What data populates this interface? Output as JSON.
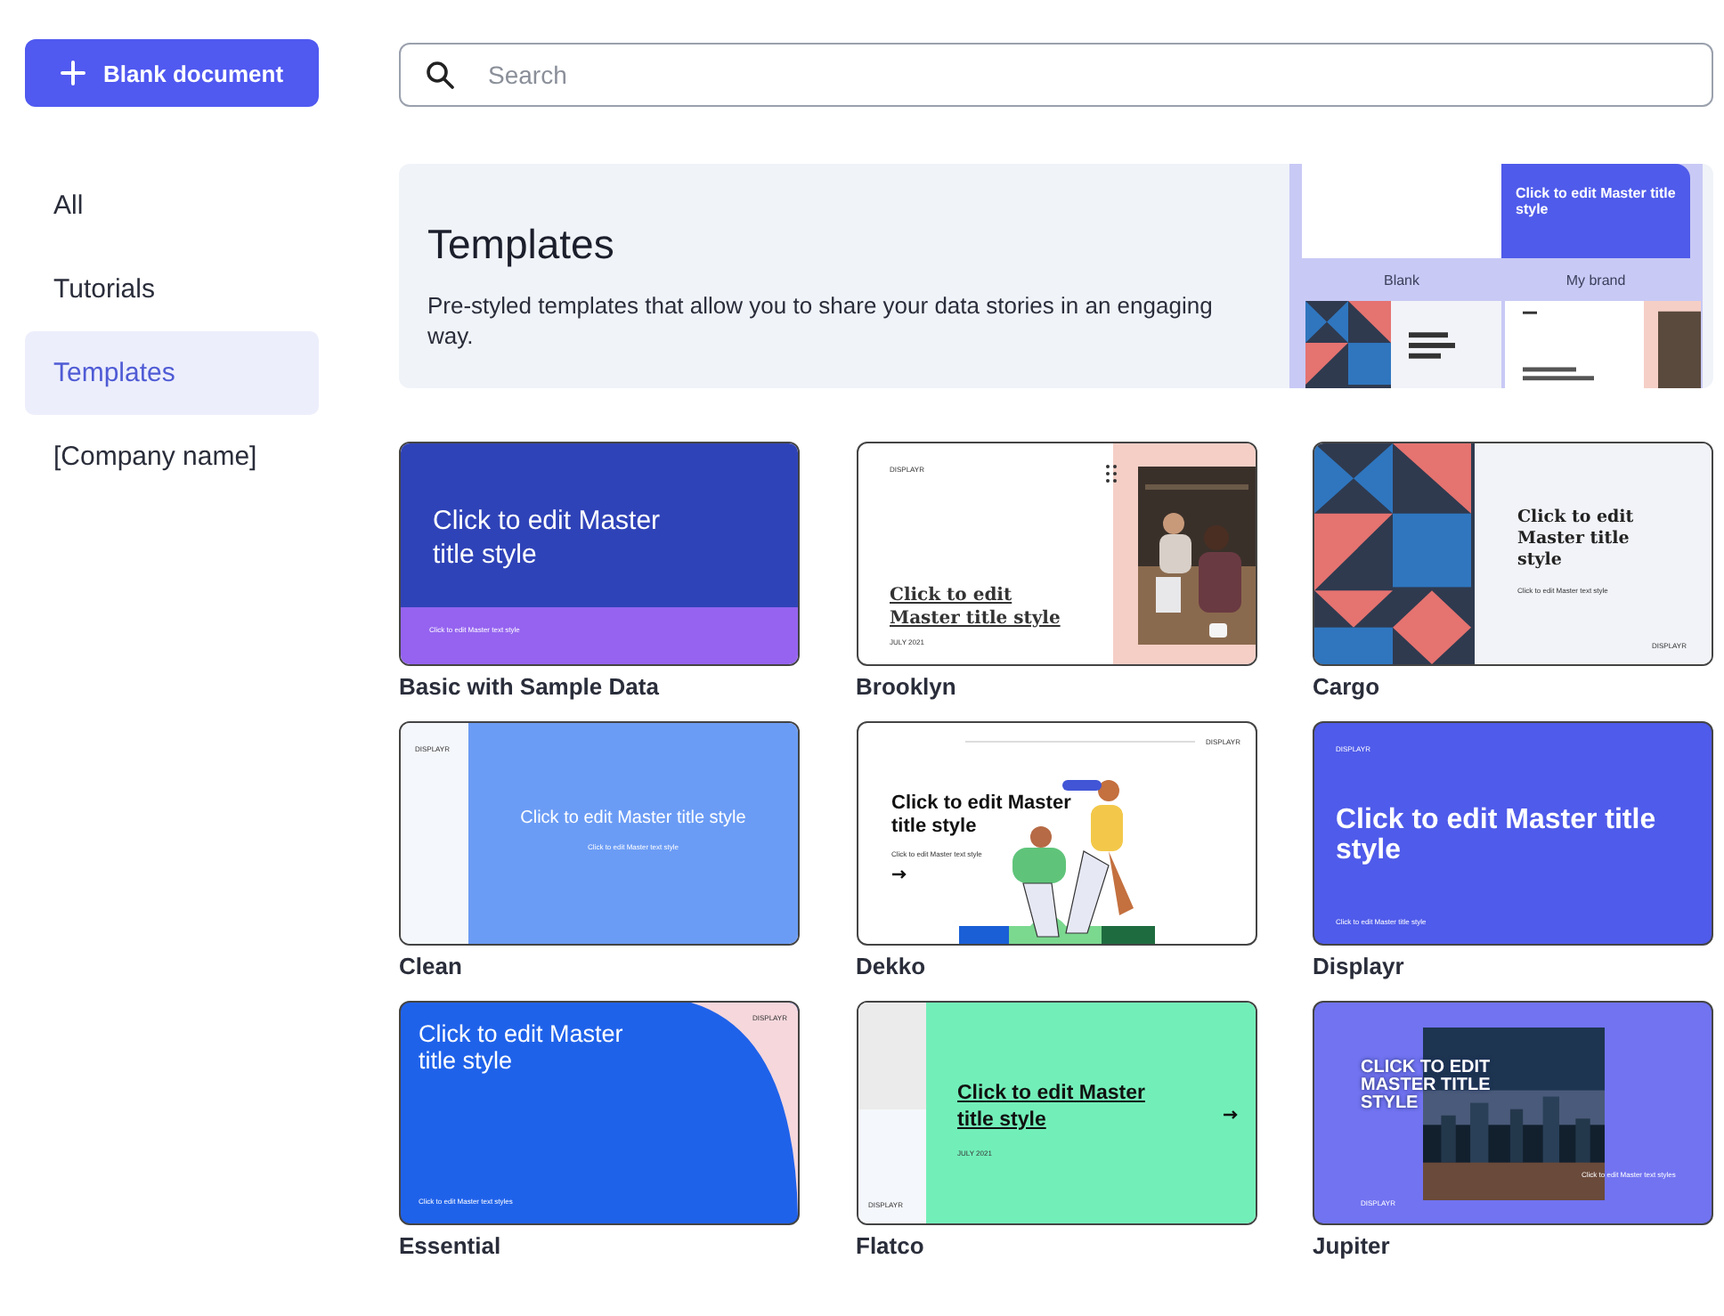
{
  "new_button": {
    "label": "Blank document"
  },
  "search": {
    "placeholder": "Search"
  },
  "sidebar": {
    "items": [
      {
        "label": "All",
        "selected": false
      },
      {
        "label": "Tutorials",
        "selected": false
      },
      {
        "label": "Templates",
        "selected": true
      },
      {
        "label": "[Company name]",
        "selected": false
      }
    ]
  },
  "banner": {
    "title": "Templates",
    "description": "Pre-styled templates that allow you to share your data stories in an engaging way.",
    "preview": {
      "brand_title": "Click to edit Master title style",
      "labels": [
        "Blank",
        "My brand"
      ]
    }
  },
  "templates": [
    {
      "name": "Basic with Sample Data",
      "kind": "basic",
      "title": "Click to edit Master title style",
      "subtitle": "Click to edit Master text style"
    },
    {
      "name": "Brooklyn",
      "kind": "brooklyn",
      "brand": "DISPLAYR",
      "title": "Click to edit Master title style",
      "date": "JULY 2021"
    },
    {
      "name": "Cargo",
      "kind": "cargo",
      "title": "Click to edit Master title style",
      "subtitle": "Click to edit Master text style",
      "brand": "DISPLAYR"
    },
    {
      "name": "Clean",
      "kind": "clean",
      "brand": "DISPLAYR",
      "title": "Click to edit Master title style",
      "subtitle": "Click to edit Master text style"
    },
    {
      "name": "Dekko",
      "kind": "dekko",
      "brand": "DISPLAYR",
      "title": "Click to edit Master title style",
      "subtitle": "Click to edit Master text style"
    },
    {
      "name": "Displayr",
      "kind": "displayr",
      "brand": "DISPLAYR",
      "title": "Click to edit Master title style",
      "subtitle": "Click to edit Master title style"
    },
    {
      "name": "Essential",
      "kind": "essential",
      "brand": "DISPLAYR",
      "title": "Click to edit Master title style",
      "subtitle": "Click to edit Master text styles"
    },
    {
      "name": "Flatco",
      "kind": "flatco",
      "title": "Click to edit Master title style",
      "date": "JULY 2021",
      "brand": "DISPLAYR"
    },
    {
      "name": "Jupiter",
      "kind": "jupiter",
      "title": "CLICK TO EDIT MASTER TITLE STYLE",
      "subtitle": "Click to edit Master text styles",
      "brand": "DISPLAYR"
    }
  ]
}
